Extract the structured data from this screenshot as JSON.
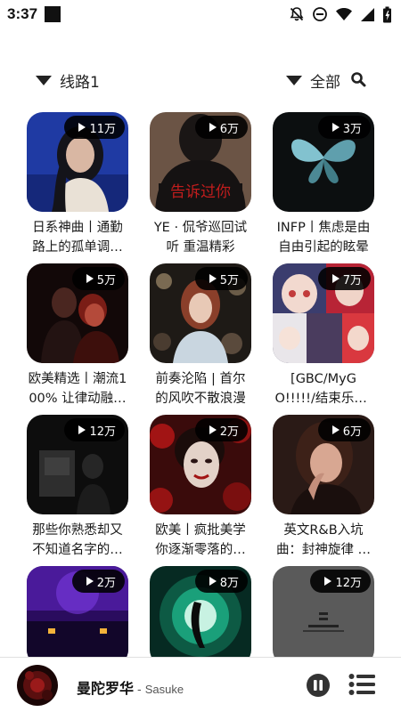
{
  "status_bar": {
    "time": "3:37"
  },
  "filters": {
    "route_label": "线路1",
    "category_label": "全部"
  },
  "playlists": [
    {
      "title": "日系神曲丨通勤路上的孤单调…",
      "plays": "11万",
      "cover_icon": "girl-portrait-blue-cover"
    },
    {
      "title": "YE · 侃爷巡回试听 重温精彩",
      "plays": "6万",
      "cover_icon": "hoodie-red-text-cover"
    },
    {
      "title": "INFP丨焦虑是由自由引起的眩晕",
      "plays": "3万",
      "cover_icon": "butterfly-dark-cover"
    },
    {
      "title": "欧美精选丨潮流100% 让律动融…",
      "plays": "5万",
      "cover_icon": "couple-dark-red-cover"
    },
    {
      "title": "前奏沦陷 | 首尔的风吹不散浪漫",
      "plays": "5万",
      "cover_icon": "girl-flowers-cover"
    },
    {
      "title": "[GBC/MyGO!!!!!/结束乐队]一次…",
      "plays": "7万",
      "cover_icon": "anime-collage-cover"
    },
    {
      "title": "那些你熟悉却又不知道名字的…",
      "plays": "12万",
      "cover_icon": "dark-room-cover"
    },
    {
      "title": "欧美丨疯批美学 你逐渐零落的…",
      "plays": "2万",
      "cover_icon": "face-red-roses-cover"
    },
    {
      "title": "英文R&B入坑曲：封神旋律 …",
      "plays": "6万",
      "cover_icon": "woman-portrait-cover"
    },
    {
      "title": "",
      "plays": "2万",
      "cover_icon": "purple-stage-cover"
    },
    {
      "title": "",
      "plays": "8万",
      "cover_icon": "green-swirl-cover"
    },
    {
      "title": "",
      "plays": "12万",
      "cover_icon": "gray-text-cover"
    }
  ],
  "player": {
    "song": "曼陀罗华",
    "separator": "-",
    "artist": "Sasuke",
    "cover_icon": "album-art-icon"
  },
  "colors": {
    "text": "#111111",
    "pill": "#000000",
    "divider": "#e0e0e0"
  }
}
